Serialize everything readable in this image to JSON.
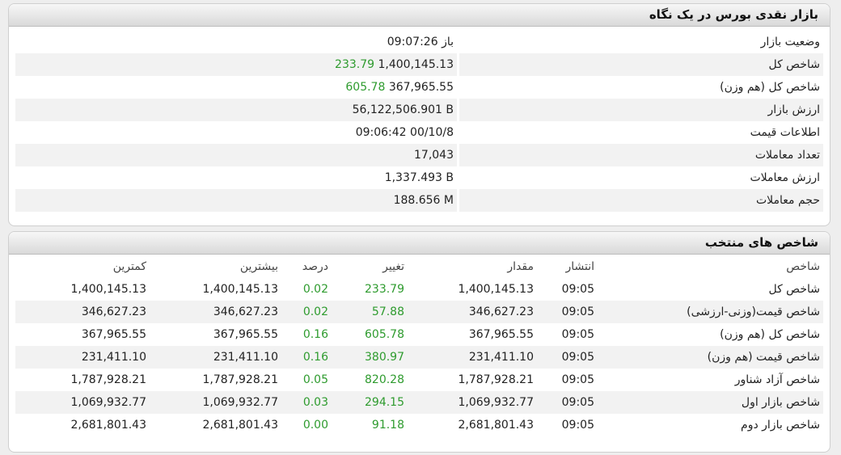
{
  "market_panel": {
    "title": "بازار نقدی بورس در یک نگاه",
    "rows": [
      {
        "label": "وضعیت بازار",
        "value": "باز 09:07:26",
        "value_extra": ""
      },
      {
        "label": "شاخص کل",
        "value": "1,400,145.13",
        "value_extra": "233.79"
      },
      {
        "label": "شاخص کل (هم وزن)",
        "value": "367,965.55",
        "value_extra": "605.78"
      },
      {
        "label": "ارزش بازار",
        "value": "56,122,506.901 B",
        "value_extra": ""
      },
      {
        "label": "اطلاعات قیمت",
        "value": "09:06:42 00/10/8",
        "value_extra": ""
      },
      {
        "label": "تعداد معاملات",
        "value": "17,043",
        "value_extra": ""
      },
      {
        "label": "ارزش معاملات",
        "value": "1,337.493 B",
        "value_extra": ""
      },
      {
        "label": "حجم معاملات",
        "value": "188.656 M",
        "value_extra": ""
      }
    ]
  },
  "index_panel": {
    "title": "شاخص های منتخب",
    "headers": {
      "name": "شاخص",
      "time": "انتشار",
      "qty": "مقدار",
      "change": "تغییر",
      "percent": "درصد",
      "max": "بیشترین",
      "min": "کمترین"
    },
    "rows": [
      {
        "name": "شاخص کل",
        "time": "09:05",
        "qty": "1,400,145.13",
        "change": "233.79",
        "percent": "0.02",
        "max": "1,400,145.13",
        "min": "1,400,145.13"
      },
      {
        "name": "شاخص قیمت(وزنی-ارزشی)",
        "time": "09:05",
        "qty": "346,627.23",
        "change": "57.88",
        "percent": "0.02",
        "max": "346,627.23",
        "min": "346,627.23"
      },
      {
        "name": "شاخص کل (هم وزن)",
        "time": "09:05",
        "qty": "367,965.55",
        "change": "605.78",
        "percent": "0.16",
        "max": "367,965.55",
        "min": "367,965.55"
      },
      {
        "name": "شاخص قیمت (هم وزن)",
        "time": "09:05",
        "qty": "231,411.10",
        "change": "380.97",
        "percent": "0.16",
        "max": "231,411.10",
        "min": "231,411.10"
      },
      {
        "name": "شاخص آزاد شناور",
        "time": "09:05",
        "qty": "1,787,928.21",
        "change": "820.28",
        "percent": "0.05",
        "max": "1,787,928.21",
        "min": "1,787,928.21"
      },
      {
        "name": "شاخص بازار اول",
        "time": "09:05",
        "qty": "1,069,932.77",
        "change": "294.15",
        "percent": "0.03",
        "max": "1,069,932.77",
        "min": "1,069,932.77"
      },
      {
        "name": "شاخص بازار دوم",
        "time": "09:05",
        "qty": "2,681,801.43",
        "change": "91.18",
        "percent": "0.00",
        "max": "2,681,801.43",
        "min": "2,681,801.43"
      }
    ]
  },
  "colors": {
    "positive": "#2e9b2e",
    "row_alt": "#f2f2f2",
    "title_bar": "#d9d9d9"
  }
}
